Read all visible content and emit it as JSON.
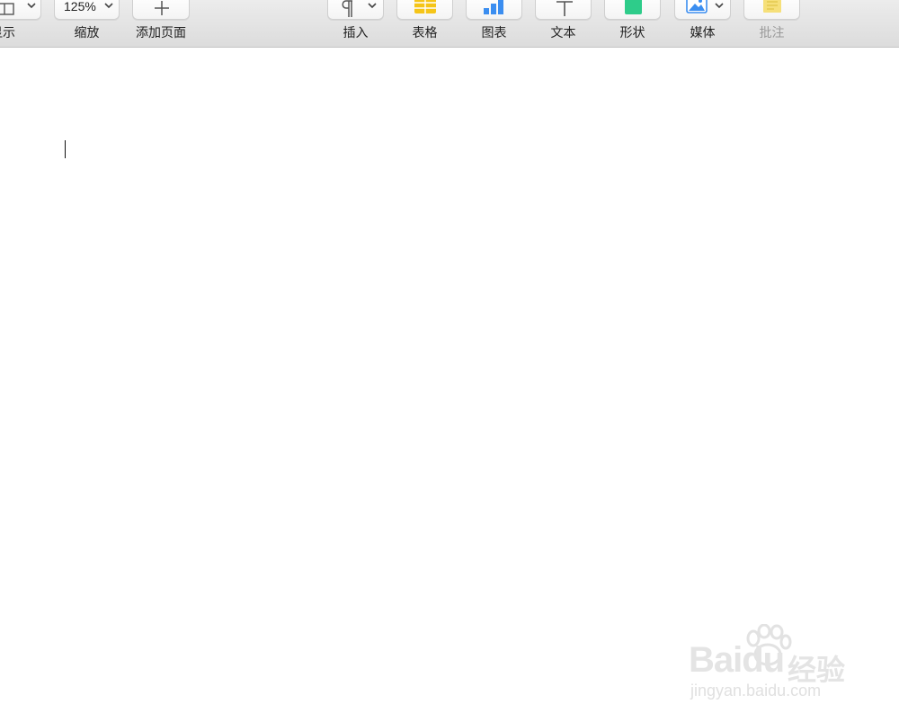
{
  "toolbar": {
    "view": {
      "label": "显示",
      "icon": "view-layout-icon"
    },
    "zoom": {
      "label": "缩放",
      "value": "125%"
    },
    "add_page": {
      "label": "添加页面",
      "icon": "plus-icon"
    },
    "insert": {
      "label": "插入",
      "icon": "paragraph-icon"
    },
    "table": {
      "label": "表格",
      "icon": "table-icon"
    },
    "chart": {
      "label": "图表",
      "icon": "chart-icon"
    },
    "text": {
      "label": "文本",
      "icon": "text-icon"
    },
    "shape": {
      "label": "形状",
      "icon": "shape-icon"
    },
    "media": {
      "label": "媒体",
      "icon": "media-icon"
    },
    "comment": {
      "label": "批注",
      "icon": "comment-icon",
      "disabled": true
    }
  },
  "watermark": {
    "logo": "Baidu",
    "logo_cn": "经验",
    "url": "jingyan.baidu.com"
  },
  "colors": {
    "table": "#f5c518",
    "chart": "#3b8ef0",
    "shape": "#2ecc8a",
    "comment": "#f6e07a"
  }
}
